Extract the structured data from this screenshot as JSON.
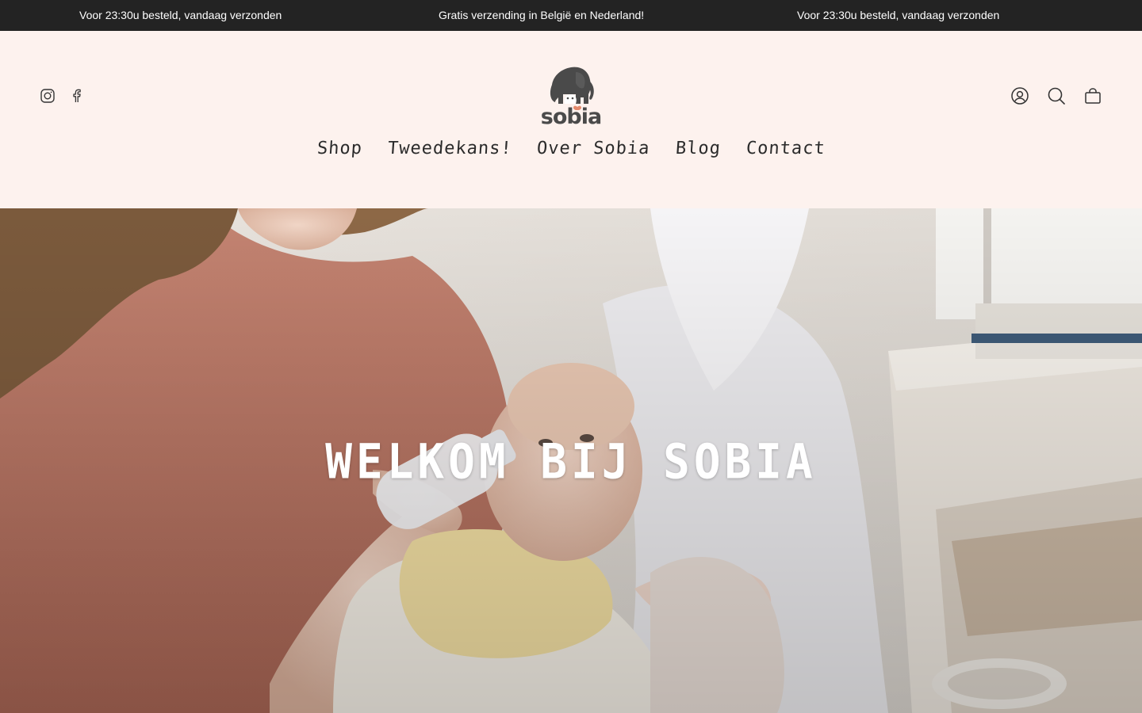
{
  "announcement": {
    "messages": [
      "Voor 23:30u besteld, vandaag verzonden",
      "Gratis verzending in België en Nederland!",
      "Voor 23:30u besteld, vandaag verzonden"
    ]
  },
  "header": {
    "logo_text": "sobia",
    "logo_icon": "elephant-logo",
    "social": [
      {
        "icon": "instagram-icon"
      },
      {
        "icon": "facebook-icon"
      }
    ],
    "actions": [
      {
        "icon": "account-icon"
      },
      {
        "icon": "search-icon"
      },
      {
        "icon": "cart-icon"
      }
    ],
    "nav": [
      "Shop",
      "Tweedekans!",
      "Over Sobia",
      "Blog",
      "Contact"
    ]
  },
  "hero": {
    "title": "WELKOM BIJ SOBIA"
  },
  "colors": {
    "announcement_bg": "#232323",
    "header_bg": "#fdf2ee",
    "logo_accent": "#e48a6c",
    "text_dark": "#2b2b2b"
  }
}
